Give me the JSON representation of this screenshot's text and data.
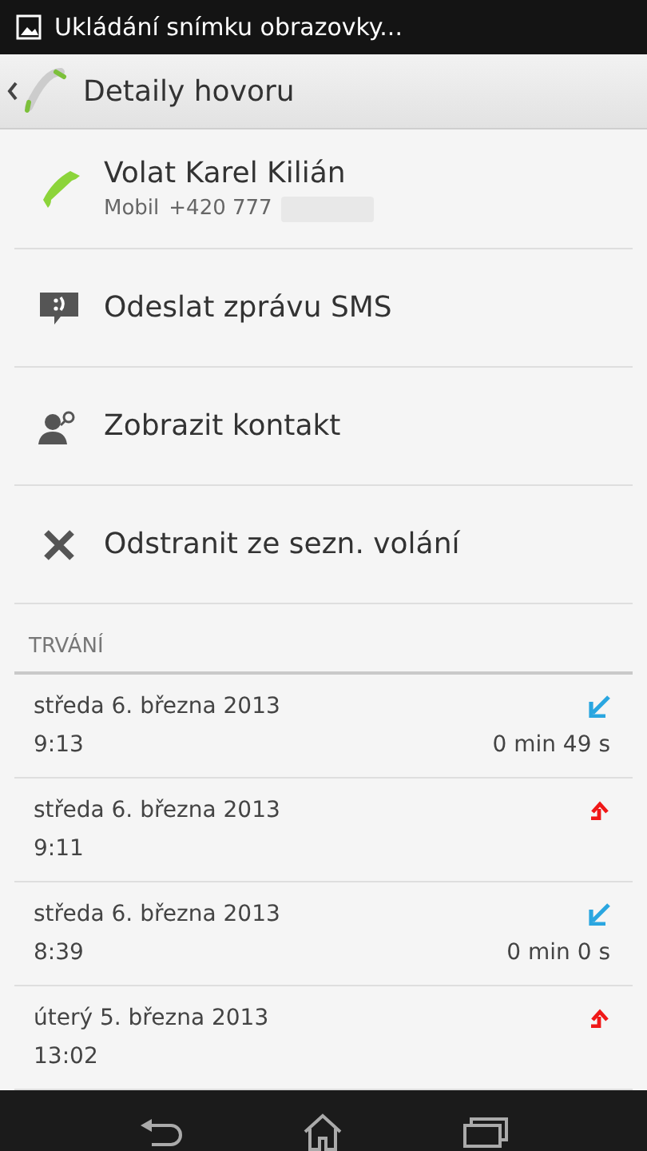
{
  "status_bar": {
    "notification": "Ukládání snímku obrazovky..."
  },
  "action_bar": {
    "title": "Detaily hovoru"
  },
  "call_action": {
    "title": "Volat Karel Kilián",
    "label": "Mobil",
    "number": "+420 777"
  },
  "actions": [
    {
      "kind": "sms",
      "label": "Odeslat zprávu SMS"
    },
    {
      "kind": "contact",
      "label": "Zobrazit kontakt"
    },
    {
      "kind": "delete",
      "label": "Odstranit ze sezn. volání"
    }
  ],
  "section_header": "TRVÁNÍ",
  "calls": [
    {
      "kind": "incoming",
      "date": "středa 6. března 2013",
      "time": "9:13",
      "duration": "0 min 49 s"
    },
    {
      "kind": "outgoing",
      "date": "středa 6. března 2013",
      "time": "9:11"
    },
    {
      "kind": "incoming",
      "date": "středa 6. března 2013",
      "time": "8:39",
      "duration": "0 min 0 s"
    },
    {
      "kind": "outgoing",
      "date": "úterý 5. března 2013",
      "time": "13:02"
    }
  ]
}
